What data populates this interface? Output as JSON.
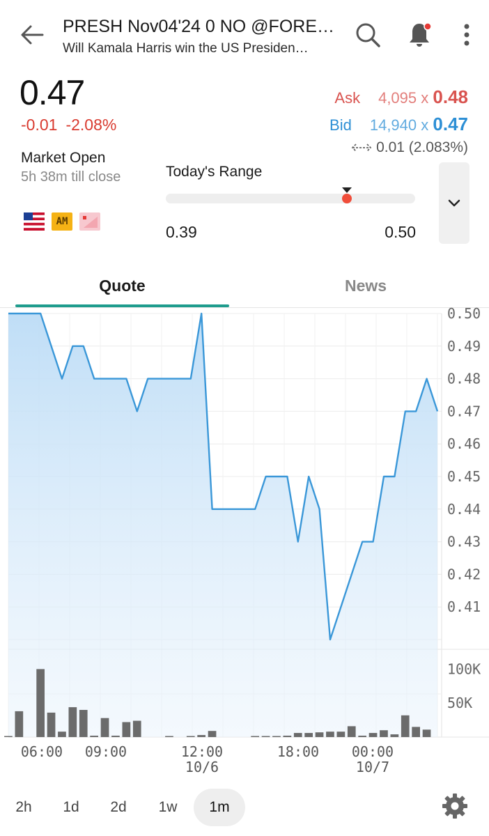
{
  "header": {
    "title": "PRESH Nov04'24 0 NO @FORE…",
    "subtitle": "Will Kamala Harris win the US Presiden…"
  },
  "quote": {
    "price": "0.47",
    "change": "-0.01",
    "change_pct": "-2.08%"
  },
  "ask": {
    "label": "Ask",
    "qty": "4,095",
    "x": "x",
    "price": "0.48"
  },
  "bid": {
    "label": "Bid",
    "qty": "14,940",
    "x": "x",
    "price": "0.47"
  },
  "spread": {
    "text": "0.01 (2.083%)"
  },
  "market": {
    "status": "Market Open",
    "till_close": "5h 38m till close",
    "badge_am": "AM"
  },
  "range": {
    "title": "Today's Range",
    "low": "0.39",
    "high": "0.50",
    "current": 0.47
  },
  "tabs": {
    "quote": "Quote",
    "news": "News"
  },
  "periods": [
    "2h",
    "1d",
    "2d",
    "1w",
    "1m"
  ],
  "active_period": "1m",
  "colors": {
    "accent": "#1f9c8d",
    "up": "#2d8fd5",
    "down": "#d93a2f",
    "line": "#3a97d8",
    "volume": "#6b6b6b"
  },
  "chart_data": {
    "type": "area",
    "price_ticks": [
      "0.50",
      "0.49",
      "0.48",
      "0.47",
      "0.46",
      "0.45",
      "0.44",
      "0.43",
      "0.42",
      "0.41"
    ],
    "volume_ticks": [
      "100K",
      "50K"
    ],
    "x_labels": [
      {
        "time": "06:00",
        "date": ""
      },
      {
        "time": "09:00",
        "date": ""
      },
      {
        "time": "12:00",
        "date": "10/6"
      },
      {
        "time": "18:00",
        "date": ""
      },
      {
        "time": "00:00",
        "date": "10/7"
      }
    ],
    "ylim": [
      0.4,
      0.5
    ],
    "price_series": [
      {
        "t": 0,
        "v": 0.5
      },
      {
        "t": 3,
        "v": 0.5
      },
      {
        "t": 5,
        "v": 0.48
      },
      {
        "t": 6,
        "v": 0.49
      },
      {
        "t": 7,
        "v": 0.49
      },
      {
        "t": 8,
        "v": 0.48
      },
      {
        "t": 11,
        "v": 0.48
      },
      {
        "t": 12,
        "v": 0.47
      },
      {
        "t": 13,
        "v": 0.48
      },
      {
        "t": 17,
        "v": 0.48
      },
      {
        "t": 18,
        "v": 0.5
      },
      {
        "t": 19,
        "v": 0.44
      },
      {
        "t": 23,
        "v": 0.44
      },
      {
        "t": 24,
        "v": 0.45
      },
      {
        "t": 26,
        "v": 0.45
      },
      {
        "t": 27,
        "v": 0.43
      },
      {
        "t": 28,
        "v": 0.45
      },
      {
        "t": 29,
        "v": 0.44
      },
      {
        "t": 30,
        "v": 0.4
      },
      {
        "t": 33,
        "v": 0.43
      },
      {
        "t": 34,
        "v": 0.43
      },
      {
        "t": 35,
        "v": 0.45
      },
      {
        "t": 36,
        "v": 0.45
      },
      {
        "t": 37,
        "v": 0.47
      },
      {
        "t": 38,
        "v": 0.47
      },
      {
        "t": 39,
        "v": 0.48
      },
      {
        "t": 40,
        "v": 0.47
      }
    ],
    "volume_series": [
      1,
      38000,
      0,
      100000,
      36000,
      8000,
      44000,
      40000,
      2000,
      28000,
      2000,
      22000,
      24000,
      0,
      0,
      1000,
      0,
      1500,
      3000,
      9000,
      0,
      0,
      0,
      1000,
      1000,
      1500,
      2000,
      6000,
      6000,
      7000,
      8000,
      8000,
      16000,
      2000,
      6000,
      10000,
      4000,
      32000,
      15000,
      11000,
      0
    ]
  }
}
